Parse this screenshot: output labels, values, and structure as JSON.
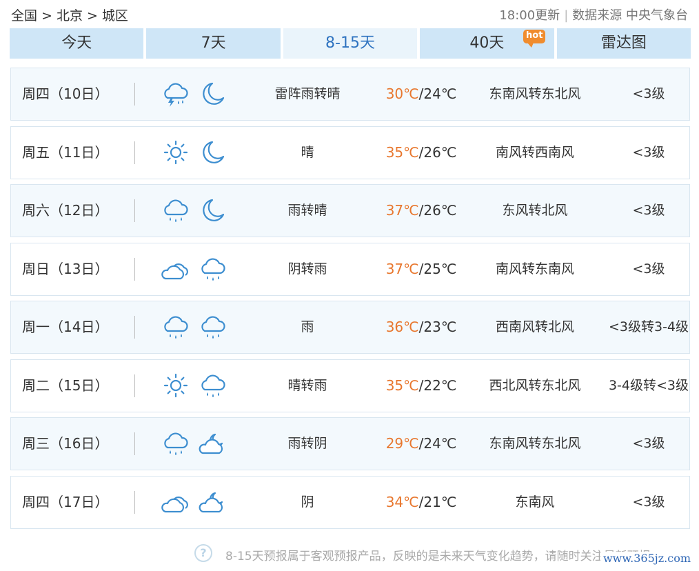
{
  "breadcrumb": {
    "country": "全国",
    "sep": ">",
    "city": "北京",
    "district": "城区"
  },
  "header": {
    "updated": "18:00更新",
    "source": "数据来源 中央气象台"
  },
  "tabs": [
    {
      "label": "今天",
      "active": false
    },
    {
      "label": "7天",
      "active": false
    },
    {
      "label": "8-15天",
      "active": true
    },
    {
      "label": "40天",
      "active": false,
      "badge": "hot"
    },
    {
      "label": "雷达图",
      "active": false
    }
  ],
  "forecast": [
    {
      "day": "周四（10日）",
      "icons": [
        "thunder-rain-icon",
        "moon-icon"
      ],
      "weather": "雷阵雨转晴",
      "high": "30℃",
      "low": "/24℃",
      "wind": "东南风转东北风",
      "level": "<3级"
    },
    {
      "day": "周五（11日）",
      "icons": [
        "sun-icon",
        "moon-icon"
      ],
      "weather": "晴",
      "high": "35℃",
      "low": "/26℃",
      "wind": "南风转西南风",
      "level": "<3级"
    },
    {
      "day": "周六（12日）",
      "icons": [
        "rain-icon",
        "moon-icon"
      ],
      "weather": "雨转晴",
      "high": "37℃",
      "low": "/26℃",
      "wind": "东风转北风",
      "level": "<3级"
    },
    {
      "day": "周日（13日）",
      "icons": [
        "cloudy-icon",
        "rain-icon"
      ],
      "weather": "阴转雨",
      "high": "37℃",
      "low": "/25℃",
      "wind": "南风转东南风",
      "level": "<3级"
    },
    {
      "day": "周一（14日）",
      "icons": [
        "rain-icon",
        "rain-icon"
      ],
      "weather": "雨",
      "high": "36℃",
      "low": "/23℃",
      "wind": "西南风转北风",
      "level": "<3级转3-4级"
    },
    {
      "day": "周二（15日）",
      "icons": [
        "sun-icon",
        "rain-icon"
      ],
      "weather": "晴转雨",
      "high": "35℃",
      "low": "/22℃",
      "wind": "西北风转东北风",
      "level": "3-4级转<3级"
    },
    {
      "day": "周三（16日）",
      "icons": [
        "rain-icon",
        "cloudy-night-icon"
      ],
      "weather": "雨转阴",
      "high": "29℃",
      "low": "/24℃",
      "wind": "东南风转东北风",
      "level": "<3级"
    },
    {
      "day": "周四（17日）",
      "icons": [
        "cloudy-icon",
        "cloudy-night-icon"
      ],
      "weather": "阴",
      "high": "34℃",
      "low": "/21℃",
      "wind": "东南风",
      "level": "<3级"
    }
  ],
  "footer": {
    "help_glyph": "?",
    "note": "8-15天预报属于客观预报产品，反映的是未来天气变化趋势，请随时关注最新预报",
    "watermark": "www.365jz.com"
  },
  "colors": {
    "tab_bg": "#cfe6f7",
    "tab_active_bg": "#eaf4fb",
    "tab_active_text": "#2f73c0",
    "high_temp": "#e8772e",
    "icon_blue": "#3d8ed0",
    "hot_badge": "#f08c2e"
  }
}
